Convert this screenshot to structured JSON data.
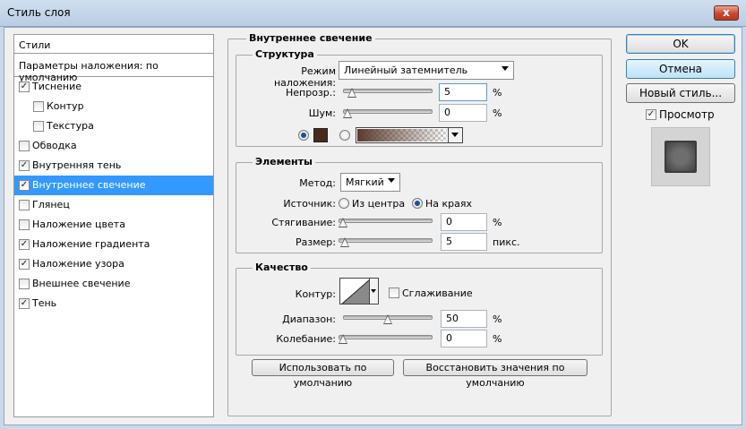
{
  "window": {
    "title": "Стиль слоя",
    "close_label": "x"
  },
  "styles": {
    "header": "Стили",
    "blend_defaults": "Параметры наложения: по умолчанию",
    "items": [
      {
        "label": "Тиснение",
        "checked": "✓"
      },
      {
        "label": "Контур",
        "checked": ""
      },
      {
        "label": "Текстура",
        "checked": ""
      },
      {
        "label": "Обводка",
        "checked": ""
      },
      {
        "label": "Внутренняя тень",
        "checked": "✓"
      },
      {
        "label": "Внутреннее свечение",
        "checked": "✓"
      },
      {
        "label": "Глянец",
        "checked": ""
      },
      {
        "label": "Наложение цвета",
        "checked": ""
      },
      {
        "label": "Наложение градиента",
        "checked": "✓"
      },
      {
        "label": "Наложение узора",
        "checked": "✓"
      },
      {
        "label": "Внешнее свечение",
        "checked": ""
      },
      {
        "label": "Тень",
        "checked": "✓"
      }
    ]
  },
  "panel_title": "Внутреннее свечение",
  "structure": {
    "legend": "Структура",
    "blend_mode_label": "Режим наложения:",
    "blend_mode_value": "Линейный затемнитель",
    "opacity_label": "Непрозр.:",
    "opacity_value": "5",
    "opacity_level": 0.05,
    "noise_label": "Шум:",
    "noise_value": "0",
    "noise_level": 0,
    "percent": "%",
    "glow_color": "#4a2a1c"
  },
  "elements": {
    "legend": "Элементы",
    "method_label": "Метод:",
    "method_value": "Мягкий",
    "source_label": "Источник:",
    "source_center": "Из центра",
    "source_edge": "На краях",
    "choke_label": "Стягивание:",
    "choke_value": "0",
    "choke_level": 0,
    "size_label": "Размер:",
    "size_value": "5",
    "size_level": 0.02,
    "percent": "%",
    "px": "пикс."
  },
  "quality": {
    "legend": "Качество",
    "contour_label": "Контур:",
    "antialias_label": "Сглаживание",
    "range_label": "Диапазон:",
    "range_value": "50",
    "range_level": 0.5,
    "jitter_label": "Колебание:",
    "jitter_value": "0",
    "jitter_level": 0,
    "percent": "%"
  },
  "buttons": {
    "make_default": "Использовать по умолчанию",
    "reset_default": "Восстановить значения по умолчанию",
    "ok": "OK",
    "cancel": "Отмена",
    "new_style": "Новый стиль...",
    "preview_label": "Просмотр"
  }
}
